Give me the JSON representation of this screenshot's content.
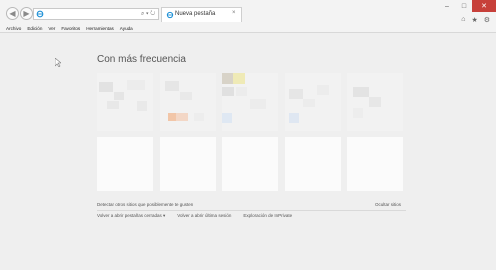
{
  "browser": {
    "tab_title": "Nueva pestaña",
    "search_placeholder": "",
    "address_tools": "⌕ ▾ ↻",
    "menu": [
      "Archivo",
      "Edición",
      "Ver",
      "Favoritos",
      "Herramientas",
      "Ayuda"
    ]
  },
  "new_tab_page": {
    "heading": "Con más frecuencia",
    "discover_link": "Detectar otros sitios que posiblemente te gusten",
    "hide_sites_link": "Ocultar sitios",
    "reopen_closed_tabs": "Volver a abrir pestañas cerradas ▾",
    "reopen_last_session": "Volver a abrir última sesión",
    "inprivate_browsing": "Exploración de InPrivate"
  },
  "colors": {
    "window_close": "#c7403a",
    "page_bg": "#efefef",
    "ie_blue": "#1b8fd6"
  },
  "icons": {
    "back": "back-arrow-icon",
    "forward": "forward-arrow-icon",
    "ie": "internet-explorer-icon",
    "home": "home-icon",
    "favorites": "star-icon",
    "tools": "gear-icon"
  }
}
